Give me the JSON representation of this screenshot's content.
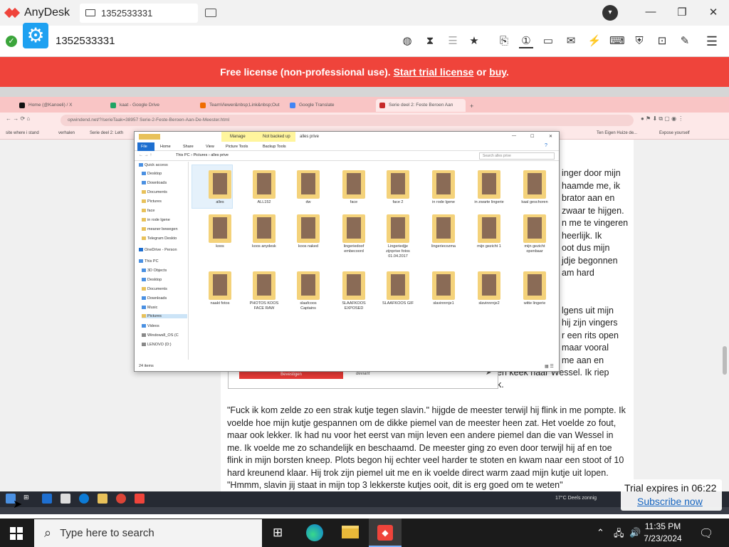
{
  "anydesk": {
    "app_name": "AnyDesk",
    "tab_id": "1352533331",
    "address_value": "1352533331",
    "banner": {
      "prefix": "Free license (non-professional use).",
      "trial_link": "Start trial license",
      "or": "or",
      "buy_link": "buy",
      "suffix": "."
    },
    "trial_expires": "Trial expires in 06:22",
    "subscribe": "Subscribe now",
    "colors": {
      "brand_red": "#ef443b",
      "settings_blue": "#1ea1f1"
    }
  },
  "remote": {
    "browser_tabs": [
      {
        "label": "Home (@Kanoeli) / X",
        "fav_color": "#111"
      },
      {
        "label": "kaat - Google Drive",
        "fav_color": "#1fa463"
      },
      {
        "label": "TeamViewer&nbsp;Link&nbsp;Out",
        "fav_color": "#ef6c00"
      },
      {
        "label": "Google Translate",
        "fav_color": "#4285f4"
      },
      {
        "label": "Serie deel 2: Feste Beroen Aan",
        "fav_color": "#c62828"
      }
    ],
    "url": "opwindend.net/?/serieTaak=38957 Serie-2-Feste-Beroen-Aan-De-Meester.html",
    "bookmarks": [
      "site where i stand",
      "verhalen",
      "Serie deel 2: Leth",
      "Ten Eigen Huize de...",
      "Expose yourself"
    ],
    "story_right_fragments": [
      "inger door mijn",
      "haamde me, ik",
      "brator aan en",
      "zwaar te hijgen.",
      "n me te vingeren",
      "heerlijk. Ik",
      "oot dus mijn",
      "jdje begonnen",
      "am hard",
      "lgens uit mijn",
      "hij zijn vingers",
      "r een rits open",
      "maar vooral",
      "me aan en",
      "en keek naar Wessel. Ik riep",
      "k."
    ],
    "story_paragraph": "\"Fuck ik kom zelde zo een strak kutje tegen slavin.\" hijgde de meester terwijl hij flink in me pompte. Ik voelde hoe mijn kutje gespannen om de dikke piemel van de meester heen zat. Het voelde zo fout, maar ook lekker. Ik had nu voor het eerst van mijn leven een andere piemel dan die van Wessel in me. Ik voelde me zo schandelijk en beschaamd. De meester ging zo even door terwijl hij af en toe flink in mijn borsten kneep. Plots begon hij echter veel harder te stoten en kwam naar een stoot of 10 hard kreunend klaar. Hij trok zijn piemel uit me en ik voelde direct warm zaad mijn kutje uit lopen. \"Hmmm, slavin jij staat in mijn top 3 lekkerste kutjes ooit, dit is erg goed om te weten\"",
    "popup_button": "Bevestigen",
    "popup_field": "deviant",
    "weather": "17°C  Deels zonnig"
  },
  "explorer": {
    "title": "alles prive",
    "tool_tabs": [
      "Manage",
      "Not backed up"
    ],
    "ribbon": [
      "File",
      "Home",
      "Share",
      "View",
      "Picture Tools",
      "Backup Tools"
    ],
    "path": "This PC  ›  Pictures  ›  alles prive",
    "search_placeholder": "Search alles prive",
    "nav": [
      "Quick access",
      "Desktop",
      "Downloads",
      "Documents",
      "Pictures",
      "face",
      "in rode lgene",
      "meaner bewegen",
      "Telegram Deskto",
      "OneDrive - Person",
      "This PC",
      "3D Objects",
      "Desktop",
      "Documents",
      "Downloads",
      "Music",
      "Pictures",
      "Videos",
      "Windows8_OS (C",
      "LENOVO (D:)"
    ],
    "folders": [
      "alles",
      "ALL152",
      "dw",
      "face",
      "face 2",
      "in rode lgene",
      "in zwarte lingerie",
      "kaal geschoren",
      "koos",
      "koos anydesk",
      "koos naked",
      "lingeriedoof embecoord",
      "Lingeriedjje zijnprive fotos 01.04.2017",
      "lingeriecozma",
      "mijn gezicht 1",
      "mijn gezicht openbaar",
      "naakt fotos",
      "PHOTOS KOOS FACE RAW",
      "slaafcoos Captains",
      "SLAAFKOOS EXPOSED",
      "SLAAFKOOS GIF",
      "slavinnrnje1",
      "slavinnrnje2",
      "witte lingerie"
    ],
    "status": "24 items"
  },
  "windows": {
    "search_placeholder": "Type here to search",
    "time": "11:35 PM",
    "date": "7/23/2024"
  }
}
